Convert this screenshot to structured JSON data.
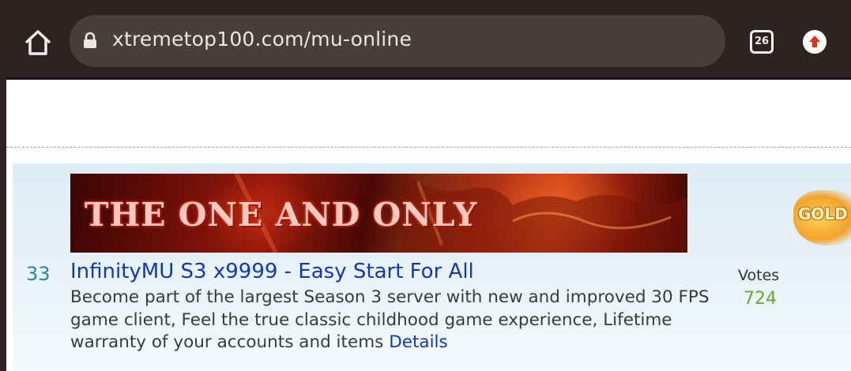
{
  "browser": {
    "url": "xtremetop100.com/mu-online",
    "tab_count": "26"
  },
  "listing": {
    "rank": "33",
    "banner_text": "THE ONE AND ONLY",
    "side_ad_text": "GOLD",
    "title": "InfinityMU S3 x9999 - Easy Start For All",
    "description": "Become part of the largest Season 3 server with new and improved 30 FPS game client, Feel the true classic childhood game experience, Lifetime warranty of your accounts and items",
    "details_label": "Details",
    "votes_label": "Votes",
    "votes_count": "724"
  },
  "colors": {
    "toolbar": "#2c2422",
    "url_bar": "#463f3c",
    "link": "#1238b8",
    "rank": "#2a86a8",
    "votes": "#6aa82c"
  },
  "icons": {
    "home": "home-icon",
    "lock": "lock-icon",
    "tabs": "tab-switcher-icon",
    "update": "update-arrow-icon"
  }
}
